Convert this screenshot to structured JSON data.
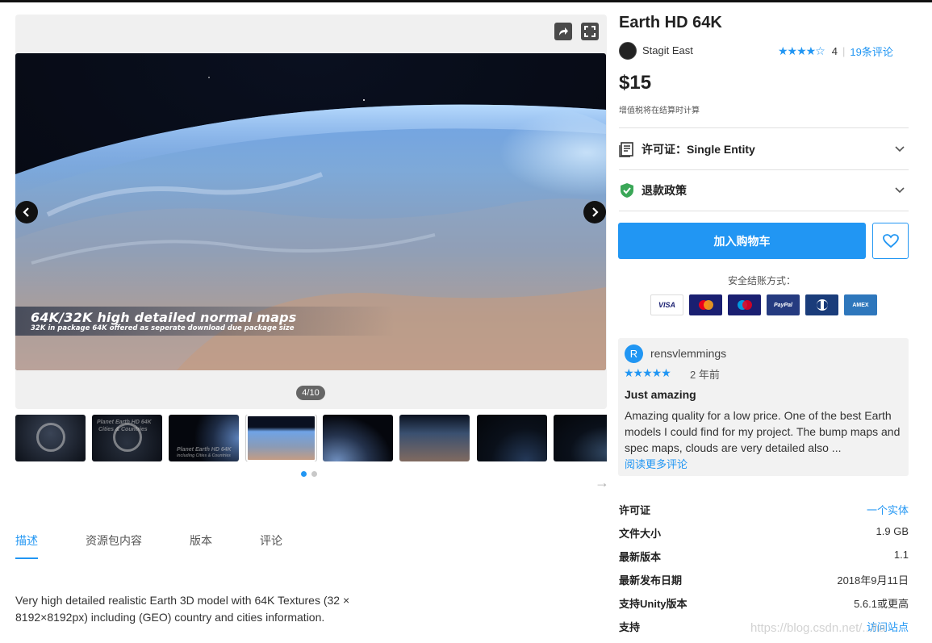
{
  "product": {
    "title": "Earth HD 64K",
    "publisher": "Stagit East",
    "rating_stars": "★★★★☆",
    "rating_value": "4",
    "rating_separator": "|",
    "reviews_link": "19条评论",
    "price": "$15",
    "vat_note": "增值税将在结算时计算"
  },
  "accordion": {
    "license_label": "许可证：Single Entity",
    "refund_label": "退款政策"
  },
  "actions": {
    "add_to_cart": "加入购物车",
    "secure_checkout": "安全结账方式："
  },
  "payments": [
    {
      "label": "VISA",
      "color": "#1a1f71"
    },
    {
      "label": "MC",
      "color": "#1a1f71"
    },
    {
      "label": "Maestro",
      "color": "#1a1f71"
    },
    {
      "label": "PayPal",
      "color": "#253b80"
    },
    {
      "label": "Diners",
      "color": "#1a3c7a"
    },
    {
      "label": "AMEX",
      "color": "#2e77bc"
    }
  ],
  "gallery": {
    "caption_title": "64K/32K high detailed normal maps",
    "caption_sub": "32K in package 64K offered as seperate download due package size",
    "counter": "4/10",
    "thumb_texts": [
      "Planet Earth HD 64K",
      "Cities & Countries",
      "Planet Earth HD 64K",
      "including Cities & Countries"
    ]
  },
  "tabs": [
    "描述",
    "资源包内容",
    "版本",
    "评论"
  ],
  "description": "Very high detailed realistic Earth 3D model with 64K Textures (32 × 8192×8192px) including (GEO) country and cities information.",
  "review": {
    "avatar_letter": "R",
    "user": "rensvlemmings",
    "stars": "★★★★★",
    "time": "2 年前",
    "title": "Just amazing",
    "body": "Amazing quality for a low price. One of the best Earth models I could find for my project. The bump maps and spec maps, clouds are very detailed also ...",
    "more": "阅读更多评论"
  },
  "meta": [
    {
      "key": "许可证",
      "value": "一个实体"
    },
    {
      "key": "文件大小",
      "value": "1.9 GB"
    },
    {
      "key": "最新版本",
      "value": "1.1"
    },
    {
      "key": "最新发布日期",
      "value": "2018年9月11日"
    },
    {
      "key": "支持Unity版本",
      "value": "5.6.1或更高"
    },
    {
      "key": "支持",
      "value": "访问站点"
    }
  ],
  "watermark": "https://blog.csdn.net/...ha",
  "colors": {
    "accent": "#2196f3",
    "text": "#212121"
  }
}
